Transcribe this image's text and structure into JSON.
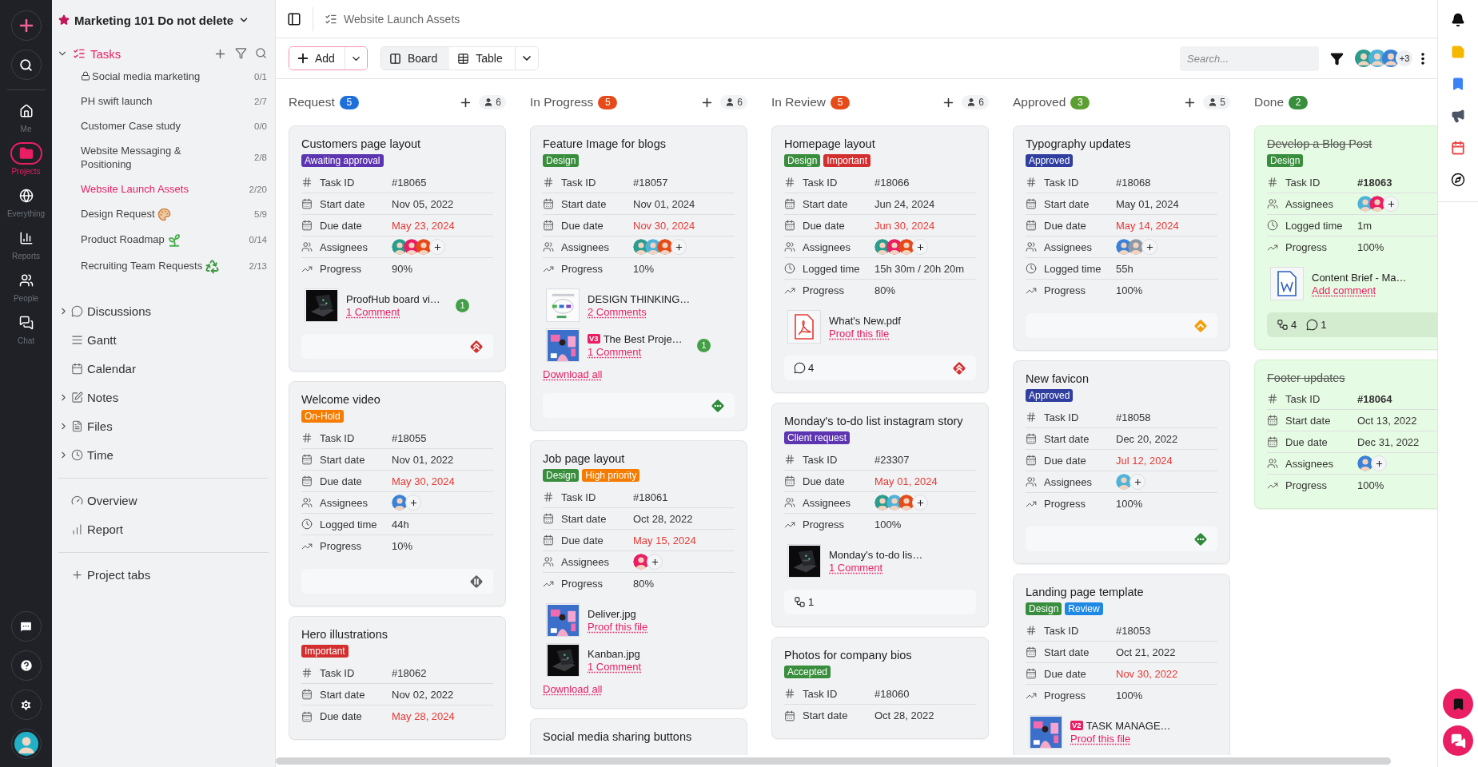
{
  "rail": {
    "items": [
      {
        "label": "Me",
        "selected": false
      },
      {
        "label": "Projects",
        "selected": true
      },
      {
        "label": "Everything",
        "selected": false
      },
      {
        "label": "Reports",
        "selected": false
      },
      {
        "label": "People",
        "selected": false
      },
      {
        "label": "Chat",
        "selected": false
      }
    ]
  },
  "sidebar": {
    "project": "Marketing 101 Do not delete",
    "starred": true,
    "tasks": {
      "label": "Tasks",
      "expanded": true,
      "items": [
        {
          "name": "Social media marketing",
          "count": "0/1",
          "kind": "locked",
          "selected": false
        },
        {
          "name": "PH swift launch",
          "count": "2/7",
          "kind": "plain",
          "selected": false
        },
        {
          "name": "Customer Case study",
          "count": "0/0",
          "kind": "plain",
          "selected": false
        },
        {
          "name": "Website Messaging & Positioning",
          "count": "2/8",
          "kind": "plain",
          "selected": false
        },
        {
          "name": "Website Launch Assets",
          "count": "2/20",
          "kind": "plain",
          "selected": true
        },
        {
          "name": "Design Request",
          "count": "5/9",
          "kind": "palette",
          "selected": false
        },
        {
          "name": "Product Roadmap",
          "count": "0/14",
          "kind": "sprout",
          "selected": false
        },
        {
          "name": "Recruiting Team Requests",
          "count": "2/13",
          "kind": "recycle",
          "selected": false
        }
      ]
    },
    "sections": [
      {
        "label": "Discussions",
        "expandable": true
      },
      {
        "label": "Gantt",
        "expandable": false
      },
      {
        "label": "Calendar",
        "expandable": false
      },
      {
        "label": "Notes",
        "expandable": true
      },
      {
        "label": "Files",
        "expandable": true
      },
      {
        "label": "Time",
        "expandable": true
      }
    ],
    "reports": [
      {
        "label": "Overview"
      },
      {
        "label": "Report"
      }
    ],
    "add_tab": "Project tabs"
  },
  "topbar": {
    "title": "Website Launch Assets"
  },
  "toolbar": {
    "add": "Add",
    "views": [
      {
        "label": "Board",
        "selected": true
      },
      {
        "label": "Table",
        "selected": false
      }
    ],
    "search": {
      "placeholder": "Search..."
    },
    "members": {
      "avatars": [
        {
          "color": "#2a9d8f"
        },
        {
          "color": "#4fb3d9"
        },
        {
          "color": "#3b82d6"
        }
      ],
      "more": "+3"
    }
  },
  "columns": [
    {
      "title": "Request",
      "count": "5",
      "color": "#1e6fd9",
      "members": "6",
      "cards": [
        {
          "title": "Customers page layout",
          "done": false,
          "tags": [
            {
              "label": "Awaiting approval",
              "color": "#5e35b1"
            }
          ],
          "fields": [
            {
              "kind": "id",
              "label": "Task ID",
              "value": "#18065"
            },
            {
              "kind": "start",
              "label": "Start date",
              "value": "Nov 05, 2022"
            },
            {
              "kind": "due",
              "label": "Due date",
              "value": "May 23, 2024",
              "overdue": true
            },
            {
              "kind": "assignees",
              "label": "Assignees",
              "avatars": [
                {
                  "color": "#2a9d8f"
                },
                {
                  "color": "#e91e63"
                },
                {
                  "color": "#e64a19"
                }
              ]
            },
            {
              "kind": "progress",
              "label": "Progress",
              "value": "90%"
            }
          ],
          "files": [
            {
              "kind": "picture",
              "name": "ProofHub board vi…",
              "link": "1 Comment",
              "badge": "1"
            }
          ],
          "footer": {
            "priority": {
              "kind": "urgent"
            }
          }
        },
        {
          "title": "Welcome video",
          "done": false,
          "tags": [
            {
              "label": "On-Hold",
              "color": "#f57c00"
            }
          ],
          "fields": [
            {
              "kind": "id",
              "label": "Task ID",
              "value": "#18055"
            },
            {
              "kind": "start",
              "label": "Start date",
              "value": "Nov 01, 2022"
            },
            {
              "kind": "due",
              "label": "Due date",
              "value": "May 30, 2024",
              "overdue": true
            },
            {
              "kind": "assignees",
              "label": "Assignees",
              "avatars": [
                {
                  "color": "#3b82d6"
                }
              ]
            },
            {
              "kind": "logged",
              "label": "Logged time",
              "value": "44h"
            },
            {
              "kind": "progress",
              "label": "Progress",
              "value": "10%"
            }
          ],
          "footer": {
            "priority": {
              "kind": "hold"
            }
          }
        },
        {
          "title": "Hero illustrations",
          "done": false,
          "tags": [
            {
              "label": "Important",
              "color": "#d32f2f"
            }
          ],
          "fields": [
            {
              "kind": "id",
              "label": "Task ID",
              "value": "#18062"
            },
            {
              "kind": "start",
              "label": "Start date",
              "value": "Nov 02, 2022"
            },
            {
              "kind": "due",
              "label": "Due date",
              "value": "May 28, 2024",
              "overdue": true
            }
          ]
        }
      ]
    },
    {
      "title": "In Progress",
      "count": "5",
      "color": "#e64a19",
      "members": "6",
      "cards": [
        {
          "title": "Feature Image for blogs",
          "done": false,
          "tags": [
            {
              "label": "Design",
              "color": "#388e3c"
            }
          ],
          "fields": [
            {
              "kind": "id",
              "label": "Task ID",
              "value": "#18057"
            },
            {
              "kind": "start",
              "label": "Start date",
              "value": "Nov 01, 2024"
            },
            {
              "kind": "due",
              "label": "Due date",
              "value": "Nov 30, 2024",
              "overdue": true
            },
            {
              "kind": "assignees",
              "label": "Assignees",
              "avatars": [
                {
                  "color": "#2a9d8f"
                },
                {
                  "color": "#4fb3d9"
                },
                {
                  "color": "#e64a19"
                }
              ]
            },
            {
              "kind": "progress",
              "label": "Progress",
              "value": "10%"
            }
          ],
          "files": [
            {
              "kind": "picture",
              "name": "DESIGN THINKING…",
              "link": "2 Comments"
            },
            {
              "kind": "picture",
              "name": "The Best Proje…",
              "version": "V3",
              "link": "1 Comment",
              "badge": "1"
            }
          ],
          "download": "Download all",
          "footer": {
            "priority": {
              "kind": "normal"
            }
          }
        },
        {
          "title": "Job page layout",
          "done": false,
          "tags": [
            {
              "label": "Design",
              "color": "#388e3c"
            },
            {
              "label": "High priority",
              "color": "#f57c00"
            }
          ],
          "fields": [
            {
              "kind": "id",
              "label": "Task ID",
              "value": "#18061"
            },
            {
              "kind": "start",
              "label": "Start date",
              "value": "Oct 28, 2022"
            },
            {
              "kind": "due",
              "label": "Due date",
              "value": "May 15, 2024",
              "overdue": true
            },
            {
              "kind": "assignees",
              "label": "Assignees",
              "avatars": [
                {
                  "color": "#e91e63"
                }
              ]
            },
            {
              "kind": "progress",
              "label": "Progress",
              "value": "80%"
            }
          ],
          "files": [
            {
              "kind": "picture",
              "name": "Deliver.jpg",
              "link": "Proof this file"
            },
            {
              "kind": "picture",
              "name": "Kanban.jpg",
              "link": "1 Comment"
            }
          ],
          "download": "Download all"
        },
        {
          "title": "Social media sharing buttons",
          "done": false
        }
      ]
    },
    {
      "title": "In Review",
      "count": "5",
      "color": "#e64a19",
      "members": "6",
      "cards": [
        {
          "title": "Homepage layout",
          "done": false,
          "tags": [
            {
              "label": "Design",
              "color": "#388e3c"
            },
            {
              "label": "Important",
              "color": "#d32f2f"
            }
          ],
          "fields": [
            {
              "kind": "id",
              "label": "Task ID",
              "value": "#18066"
            },
            {
              "kind": "start",
              "label": "Start date",
              "value": "Jun 24, 2024"
            },
            {
              "kind": "due",
              "label": "Due date",
              "value": "Jun 30, 2024",
              "overdue": true
            },
            {
              "kind": "assignees",
              "label": "Assignees",
              "avatars": [
                {
                  "color": "#2a9d8f"
                },
                {
                  "color": "#e91e63"
                },
                {
                  "color": "#e64a19"
                }
              ]
            },
            {
              "kind": "logged",
              "label": "Logged time",
              "value": "15h 30m / 20h 20m"
            },
            {
              "kind": "progress",
              "label": "Progress",
              "value": "80%"
            }
          ],
          "files": [
            {
              "kind": "pdf",
              "name": "What's New.pdf",
              "link": "Proof this file"
            }
          ],
          "footer": {
            "comments": "4",
            "priority": {
              "kind": "urgent"
            }
          }
        },
        {
          "title": "Monday's to-do list instagram story",
          "done": false,
          "tags": [
            {
              "label": "Client request",
              "color": "#5e35b1"
            }
          ],
          "fields": [
            {
              "kind": "id",
              "label": "Task ID",
              "value": "#23307"
            },
            {
              "kind": "due",
              "label": "Due date",
              "value": "May 01, 2024",
              "overdue": true
            },
            {
              "kind": "assignees",
              "label": "Assignees",
              "avatars": [
                {
                  "color": "#2a9d8f"
                },
                {
                  "color": "#4fb3d9"
                },
                {
                  "color": "#e64a19"
                }
              ]
            },
            {
              "kind": "progress",
              "label": "Progress",
              "value": "100%"
            }
          ],
          "files": [
            {
              "kind": "picture",
              "name": "Monday's to-do lis…",
              "link": "1 Comment"
            }
          ],
          "footer": {
            "subtasks": "1"
          }
        },
        {
          "title": "Photos for company bios",
          "done": false,
          "tags": [
            {
              "label": "Accepted",
              "color": "#388e3c"
            }
          ],
          "fields": [
            {
              "kind": "id",
              "label": "Task ID",
              "value": "#18060"
            },
            {
              "kind": "start",
              "label": "Start date",
              "value": "Oct 28, 2022"
            }
          ]
        }
      ]
    },
    {
      "title": "Approved",
      "count": "3",
      "color": "#5c9e31",
      "members": "5",
      "cards": [
        {
          "title": "Typography updates",
          "done": false,
          "tags": [
            {
              "label": "Approved",
              "color": "#303f9f"
            }
          ],
          "fields": [
            {
              "kind": "id",
              "label": "Task ID",
              "value": "#18068"
            },
            {
              "kind": "start",
              "label": "Start date",
              "value": "May 01, 2024"
            },
            {
              "kind": "due",
              "label": "Due date",
              "value": "May 14, 2024",
              "overdue": true
            },
            {
              "kind": "assignees",
              "label": "Assignees",
              "avatars": [
                {
                  "color": "#3b82d6"
                },
                {
                  "color": "#8d9aa5"
                }
              ]
            },
            {
              "kind": "logged",
              "label": "Logged time",
              "value": "55h"
            },
            {
              "kind": "progress",
              "label": "Progress",
              "value": "100%"
            }
          ],
          "footer": {
            "priority": {
              "kind": "high"
            }
          }
        },
        {
          "title": "New favicon",
          "done": false,
          "tags": [
            {
              "label": "Approved",
              "color": "#303f9f"
            }
          ],
          "fields": [
            {
              "kind": "id",
              "label": "Task ID",
              "value": "#18058"
            },
            {
              "kind": "start",
              "label": "Start date",
              "value": "Dec 20, 2022"
            },
            {
              "kind": "due",
              "label": "Due date",
              "value": "Jul 12, 2024",
              "overdue": true
            },
            {
              "kind": "assignees",
              "label": "Assignees",
              "avatars": [
                {
                  "color": "#4fb3d9"
                }
              ]
            },
            {
              "kind": "progress",
              "label": "Progress",
              "value": "100%"
            }
          ],
          "footer": {
            "priority": {
              "kind": "normal"
            }
          }
        },
        {
          "title": "Landing page template",
          "done": false,
          "tags": [
            {
              "label": "Design",
              "color": "#388e3c"
            },
            {
              "label": "Review",
              "color": "#1e88e5"
            }
          ],
          "fields": [
            {
              "kind": "id",
              "label": "Task ID",
              "value": "#18053"
            },
            {
              "kind": "start",
              "label": "Start date",
              "value": "Oct 21, 2022"
            },
            {
              "kind": "due",
              "label": "Due date",
              "value": "Nov 30, 2022",
              "overdue": true
            },
            {
              "kind": "progress",
              "label": "Progress",
              "value": "100%"
            }
          ],
          "files": [
            {
              "kind": "picture",
              "name": "TASK MANAGE…",
              "version": "V2",
              "link": "Proof this file"
            }
          ]
        }
      ]
    },
    {
      "title": "Done",
      "count": "2",
      "color": "#388e3c",
      "cards": [
        {
          "title": "Develop a Blog Post",
          "done": true,
          "tags": [
            {
              "label": "Design",
              "color": "#388e3c"
            }
          ],
          "fields": [
            {
              "kind": "id",
              "label": "Task ID",
              "value": "#18063"
            },
            {
              "kind": "assignees",
              "label": "Assignees",
              "avatars": [
                {
                  "color": "#4fb3d9"
                },
                {
                  "color": "#e91e63"
                }
              ]
            },
            {
              "kind": "logged",
              "label": "Logged time",
              "value": "1m"
            },
            {
              "kind": "progress",
              "label": "Progress",
              "value": "100%"
            }
          ],
          "files": [
            {
              "kind": "doc",
              "name": "Content Brief - Ma…",
              "link": "Add comment"
            }
          ],
          "footer": {
            "subtasks": "4",
            "comments": "1"
          }
        },
        {
          "title": "Footer updates",
          "done": true,
          "fields": [
            {
              "kind": "id",
              "label": "Task ID",
              "value": "#18064"
            },
            {
              "kind": "start",
              "label": "Start date",
              "value": "Oct 13, 2022"
            },
            {
              "kind": "due",
              "label": "Due date",
              "value": "Dec 31, 2022",
              "overdue": false
            },
            {
              "kind": "assignees",
              "label": "Assignees",
              "avatars": [
                {
                  "color": "#3b82d6"
                }
              ]
            },
            {
              "kind": "progress",
              "label": "Progress",
              "value": "100%"
            }
          ]
        }
      ]
    }
  ]
}
